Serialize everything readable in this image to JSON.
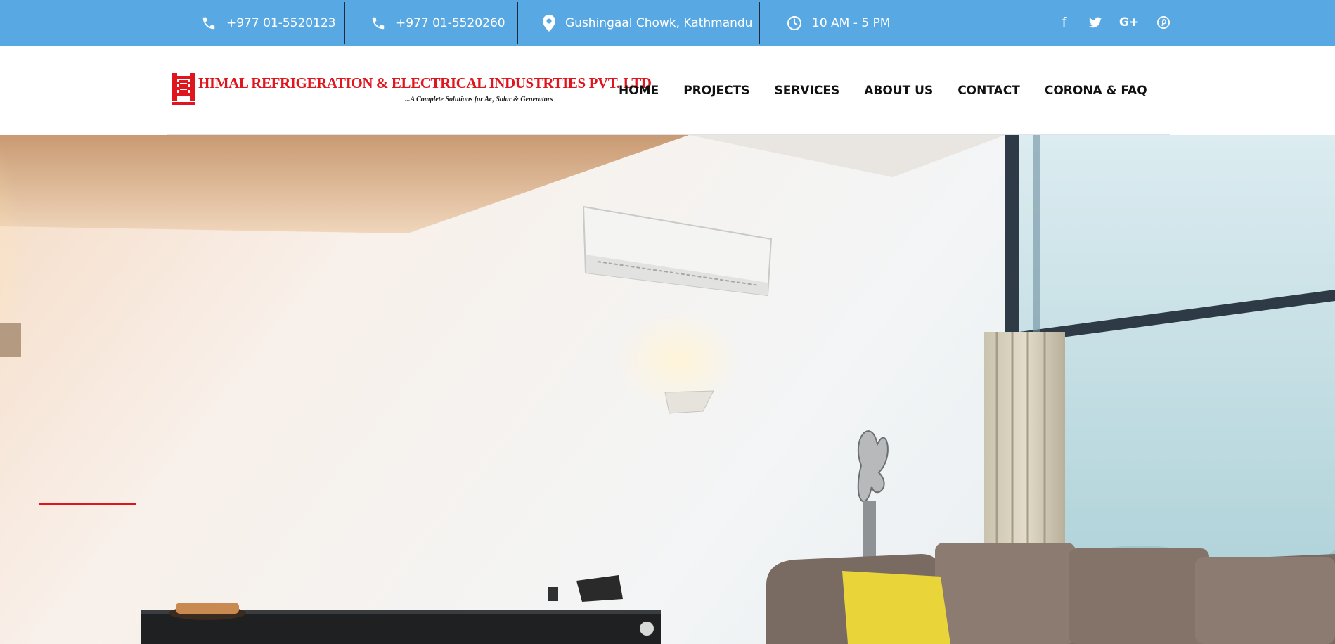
{
  "topbar": {
    "phone1": "+977 01-5520123",
    "phone2": "+977 01-5520260",
    "address": "Gushingaal Chowk, Kathmandu",
    "hours": "10 AM - 5 PM",
    "social": {
      "facebook": "f",
      "twitter": "twitter-icon",
      "google_plus": "G+",
      "pinterest": "pinterest-icon"
    },
    "icons": [
      "phone-icon",
      "phone-icon",
      "map-marker-icon",
      "clock-icon"
    ]
  },
  "header": {
    "logo_name": "HIMAL REFRIGERATION & ELECTRICAL INDUSTRTIES PVT. LTD.",
    "logo_tagline": "...A Complete Solutions for Ac, Solar & Generators",
    "nav": [
      "HOME",
      "PROJECTS",
      "SERVICES",
      "ABOUT US",
      "CONTACT",
      "CORONA & FAQ"
    ]
  },
  "colors": {
    "topbar_bg": "#57a8e3",
    "brand_red": "#e0161e",
    "nav_text": "#111111",
    "slider_indicator": "#e0161e"
  }
}
